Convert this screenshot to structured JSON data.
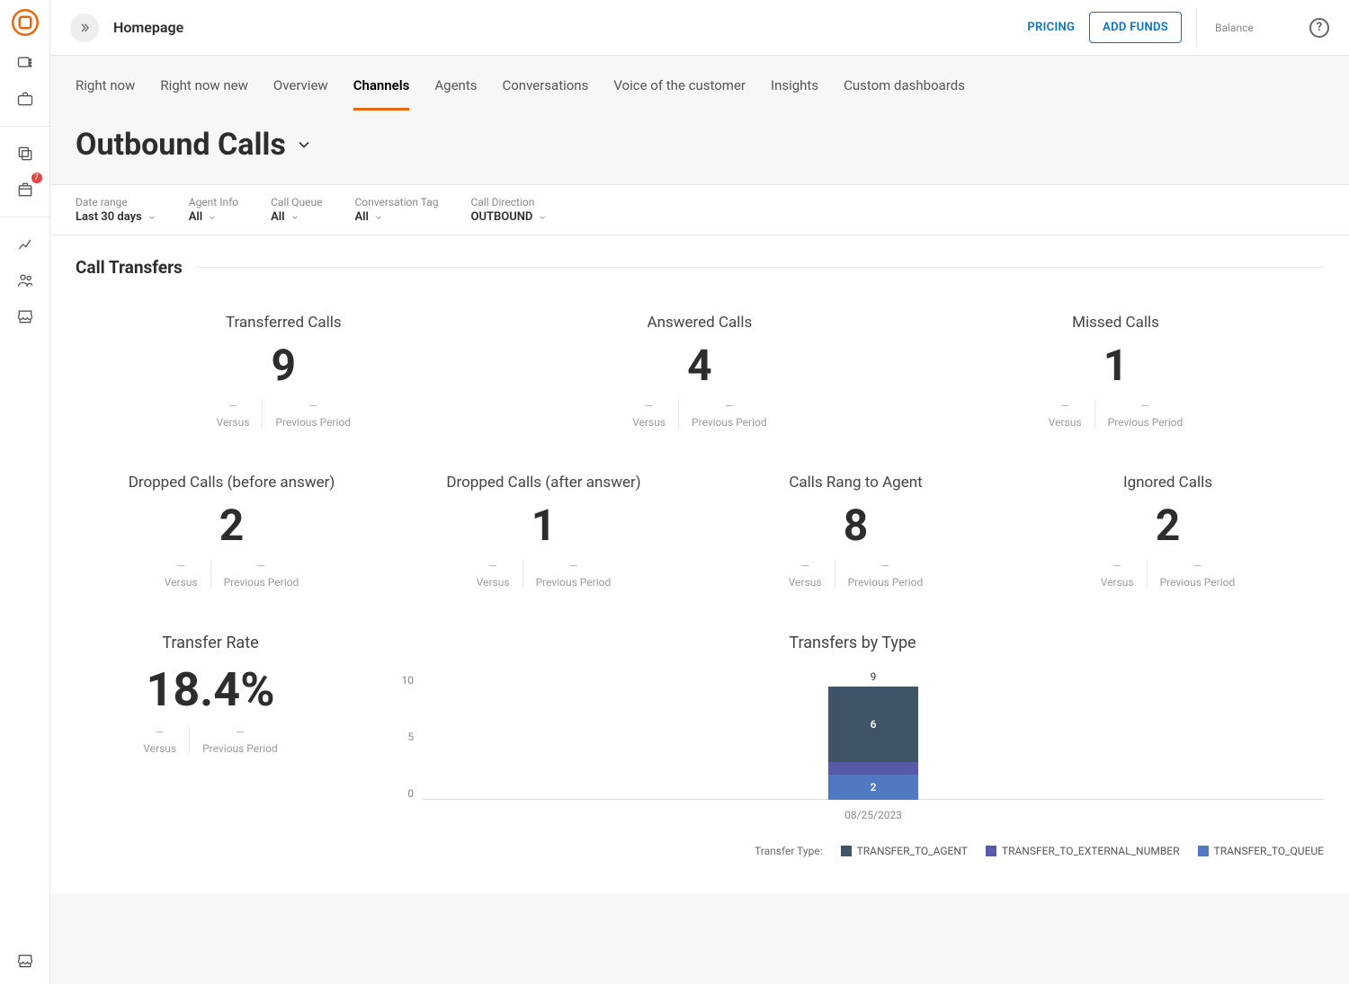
{
  "header": {
    "title": "Homepage",
    "pricing": "PRICING",
    "add_funds": "ADD FUNDS",
    "balance_label": "Balance"
  },
  "sidebar": {
    "badge_count": "7"
  },
  "tabs": [
    {
      "label": "Right now"
    },
    {
      "label": "Right now new"
    },
    {
      "label": "Overview"
    },
    {
      "label": "Channels"
    },
    {
      "label": "Agents"
    },
    {
      "label": "Conversations"
    },
    {
      "label": "Voice of the customer"
    },
    {
      "label": "Insights"
    },
    {
      "label": "Custom dashboards"
    }
  ],
  "page": {
    "title": "Outbound Calls"
  },
  "filters": [
    {
      "label": "Date range",
      "value": "Last 30 days"
    },
    {
      "label": "Agent Info",
      "value": "All"
    },
    {
      "label": "Call Queue",
      "value": "All"
    },
    {
      "label": "Conversation Tag",
      "value": "All"
    },
    {
      "label": "Call Direction",
      "value": "OUTBOUND"
    }
  ],
  "section_title": "Call Transfers",
  "compare": {
    "versus_label": "Versus",
    "previous_label": "Previous Period",
    "dash": "—"
  },
  "kpis_row1": [
    {
      "label": "Transferred Calls",
      "value": "9"
    },
    {
      "label": "Answered Calls",
      "value": "4"
    },
    {
      "label": "Missed Calls",
      "value": "1"
    }
  ],
  "kpis_row2": [
    {
      "label": "Dropped Calls (before answer)",
      "value": "2"
    },
    {
      "label": "Dropped Calls (after answer)",
      "value": "1"
    },
    {
      "label": "Calls Rang to Agent",
      "value": "8"
    },
    {
      "label": "Ignored Calls",
      "value": "2"
    }
  ],
  "transfer_rate": {
    "label": "Transfer Rate",
    "value": "18.4%"
  },
  "chart_data": {
    "type": "bar",
    "title": "Transfers by Type",
    "categories": [
      "08/25/2023"
    ],
    "ylim": [
      0,
      10
    ],
    "yticks": [
      0,
      5,
      10
    ],
    "total": 9,
    "series": [
      {
        "name": "TRANSFER_TO_AGENT",
        "color": "#3f5466",
        "values": [
          6
        ]
      },
      {
        "name": "TRANSFER_TO_EXTERNAL_NUMBER",
        "color": "#575aa6",
        "values": [
          1
        ]
      },
      {
        "name": "TRANSFER_TO_QUEUE",
        "color": "#5179c2",
        "values": [
          2
        ]
      }
    ],
    "legend_title": "Transfer Type:"
  }
}
